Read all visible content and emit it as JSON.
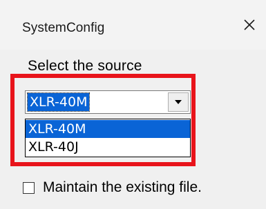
{
  "window": {
    "title": "SystemConfig",
    "close_icon": "close-icon"
  },
  "source": {
    "label": "Select the source",
    "selected_value": "XLR-40M",
    "options": [
      "XLR-40M",
      "XLR-40J"
    ],
    "highlight_color": "#e8141b",
    "selection_color": "#0a64d6"
  },
  "options": {
    "maintain_label": "Maintain the existing file.",
    "maintain_checked": false
  }
}
